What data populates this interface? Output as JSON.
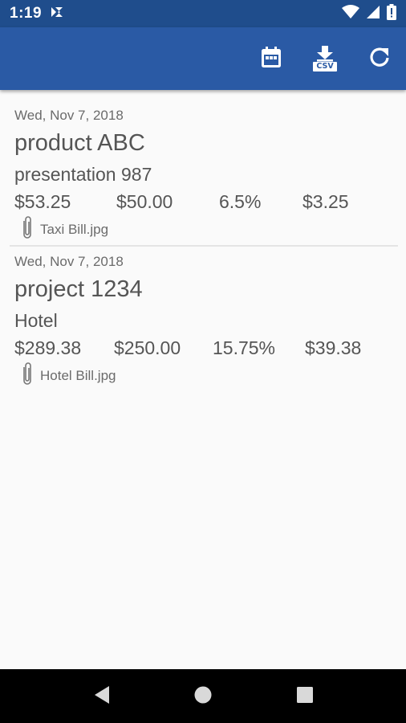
{
  "status_bar": {
    "time": "1:19",
    "icons": [
      "notification-app-icon",
      "wifi-icon",
      "cell-signal-icon",
      "battery-icon"
    ]
  },
  "toolbar": {
    "actions": [
      {
        "name": "calendar-icon",
        "label": ""
      },
      {
        "name": "download-csv-icon",
        "label": "CSV"
      },
      {
        "name": "refresh-icon",
        "label": ""
      }
    ]
  },
  "entries": [
    {
      "date": "Wed, Nov 7, 2018",
      "title": "product ABC",
      "subtitle": "presentation 987",
      "amounts": [
        "$53.25",
        "$50.00",
        "6.5%",
        "$3.25"
      ],
      "attachment": "Taxi Bill.jpg"
    },
    {
      "date": "Wed, Nov 7, 2018",
      "title": "project 1234",
      "subtitle": "Hotel",
      "amounts": [
        "$289.38",
        "$250.00",
        "15.75%",
        "$39.38"
      ],
      "attachment": "Hotel Bill.jpg"
    }
  ],
  "nav_bar": {
    "buttons": [
      "back-icon",
      "home-icon",
      "recents-icon"
    ]
  },
  "colors": {
    "status_bar": "#1f4d8c",
    "toolbar": "#2a5aa5",
    "background": "#fafafa",
    "text": "#555555"
  }
}
